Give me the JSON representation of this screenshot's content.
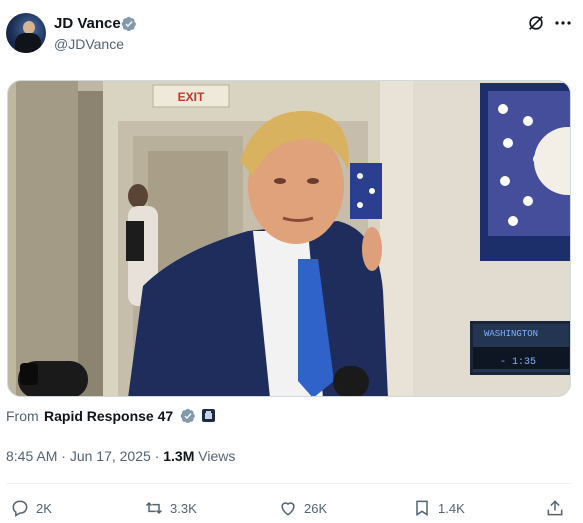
{
  "author": {
    "name": "JD Vance",
    "handle": "@JDVance"
  },
  "media": {
    "exit_sign": "EXIT",
    "display_location": "WASHINGTON",
    "display_time": "- 1:35"
  },
  "attribution": {
    "prefix": "From",
    "source": "Rapid Response 47"
  },
  "meta": {
    "time": "8:45 AM",
    "sep1": " · ",
    "date": "Jun 17, 2025",
    "sep2": " · ",
    "views_count": "1.3M",
    "views_label": " Views"
  },
  "actions": {
    "replies": "2K",
    "reposts": "3.3K",
    "likes": "26K",
    "bookmarks": "1.4K"
  },
  "colors": {
    "accent_blue": "#1d9bf0",
    "muted_text": "#536471"
  }
}
